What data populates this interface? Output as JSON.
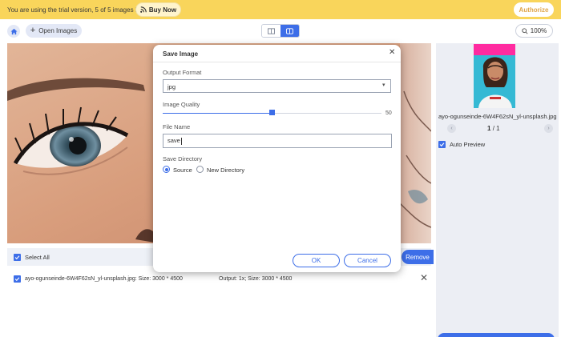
{
  "banner": {
    "trial_text": "You are using the trial version, 5 of 5 images left.",
    "buy_label": "Buy Now",
    "authorize_label": "Authorize"
  },
  "toolbar": {
    "open_label": "Open Images",
    "zoom_label": "100%",
    "home_icon": "home-icon",
    "view_modes": [
      "single-view",
      "split-view"
    ],
    "active_view": "split-view"
  },
  "list": {
    "select_all_label": "Select All",
    "remove_label": "Remove",
    "files": [
      {
        "name": "ayo-ogunseinde-6W4F62sN_yl-unsplash.jpg: Size: 3000 * 4500",
        "output": "Output: 1x; Size: 3000 * 4500"
      }
    ]
  },
  "sidebar": {
    "thumb_name": "ayo-ogunseinde-6W4F62sN_yl-unsplash.jpg",
    "page_current": "1",
    "page_total": "/ 1",
    "auto_preview_label": "Auto Preview"
  },
  "dialog": {
    "title": "Save Image",
    "output_format_label": "Output Format",
    "output_format_value": "jpg",
    "image_quality_label": "Image Quality",
    "image_quality_value": "50",
    "quality_fraction": 0.5,
    "file_name_label": "File Name",
    "file_name_value": "save",
    "save_directory_label": "Save Directory",
    "directory_options": [
      "Source",
      "New Directory"
    ],
    "directory_selected": "Source",
    "ok_label": "OK",
    "cancel_label": "Cancel"
  },
  "colors": {
    "accent": "#3d6ee8",
    "banner": "#f9d55b",
    "authorize_text": "#e0a64a",
    "sidebar_bg": "#eceef4"
  }
}
